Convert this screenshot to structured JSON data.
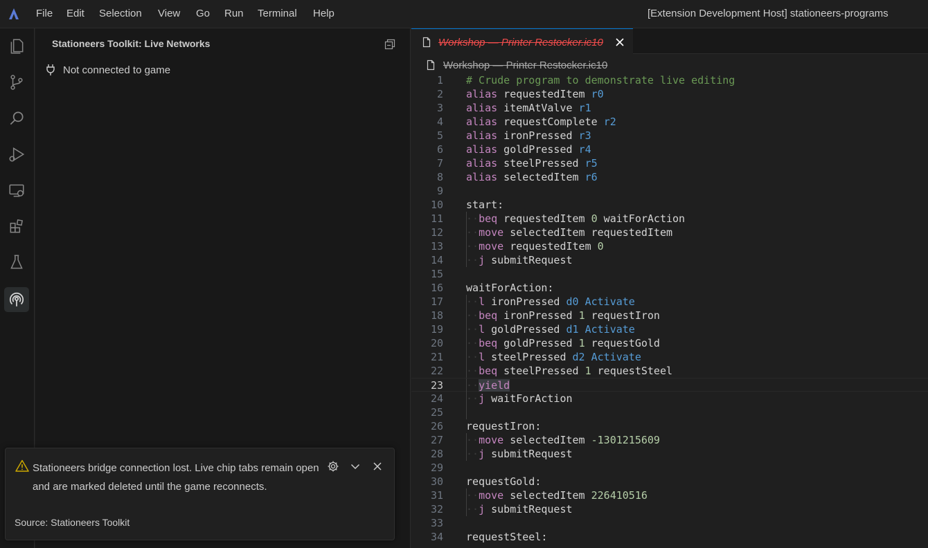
{
  "menu": [
    "File",
    "Edit",
    "Selection",
    "View",
    "Go",
    "Run",
    "Terminal",
    "Help"
  ],
  "window_title": "[Extension Development Host] stationeers-programs",
  "activity_bar": [
    {
      "icon": "explorer-icon"
    },
    {
      "icon": "source-control-icon"
    },
    {
      "icon": "search-icon"
    },
    {
      "icon": "run-and-debug-icon"
    },
    {
      "icon": "remote-explorer-icon"
    },
    {
      "icon": "extensions-icon"
    },
    {
      "icon": "testing-icon"
    },
    {
      "icon": "live-networks-icon",
      "active": true
    }
  ],
  "sidebar": {
    "title": "Stationeers Toolkit: Live Networks",
    "status": "Not connected to game"
  },
  "notification": {
    "message": "Stationeers bridge connection lost. Live chip tabs remain open and are marked deleted until the game reconnects.",
    "source": "Source: Stationeers Toolkit"
  },
  "editor": {
    "tab_label": "Workshop — Printer Restocker.ic10",
    "breadcrumb": "Workshop — Printer Restocker.ic10",
    "current_line": 23,
    "lines": [
      [
        [
          "# Crude program to demonstrate live editing",
          "cmt"
        ]
      ],
      [
        [
          "alias",
          "kw"
        ],
        [
          " requestedItem ",
          "id"
        ],
        [
          "r0",
          "reg"
        ]
      ],
      [
        [
          "alias",
          "kw"
        ],
        [
          " itemAtValve ",
          "id"
        ],
        [
          "r1",
          "reg"
        ]
      ],
      [
        [
          "alias",
          "kw"
        ],
        [
          " requestComplete ",
          "id"
        ],
        [
          "r2",
          "reg"
        ]
      ],
      [
        [
          "alias",
          "kw"
        ],
        [
          " ironPressed ",
          "id"
        ],
        [
          "r3",
          "reg"
        ]
      ],
      [
        [
          "alias",
          "kw"
        ],
        [
          " goldPressed ",
          "id"
        ],
        [
          "r4",
          "reg"
        ]
      ],
      [
        [
          "alias",
          "kw"
        ],
        [
          " steelPressed ",
          "id"
        ],
        [
          "r5",
          "reg"
        ]
      ],
      [
        [
          "alias",
          "kw"
        ],
        [
          " selectedItem ",
          "id"
        ],
        [
          "r6",
          "reg"
        ]
      ],
      [],
      [
        [
          "start:",
          "id"
        ]
      ],
      [
        [
          "··",
          "ws"
        ],
        [
          "beq",
          "kw"
        ],
        [
          " requestedItem ",
          "id"
        ],
        [
          "0",
          "num"
        ],
        [
          " waitForAction",
          "id"
        ]
      ],
      [
        [
          "··",
          "ws"
        ],
        [
          "move",
          "kw"
        ],
        [
          " selectedItem requestedItem",
          "id"
        ]
      ],
      [
        [
          "··",
          "ws"
        ],
        [
          "move",
          "kw"
        ],
        [
          " requestedItem ",
          "id"
        ],
        [
          "0",
          "num"
        ]
      ],
      [
        [
          "··",
          "ws"
        ],
        [
          "j",
          "kw"
        ],
        [
          " submitRequest",
          "id"
        ]
      ],
      [],
      [
        [
          "waitForAction:",
          "id"
        ]
      ],
      [
        [
          "··",
          "ws"
        ],
        [
          "l",
          "kw"
        ],
        [
          " ironPressed ",
          "id"
        ],
        [
          "d0",
          "reg"
        ],
        [
          " ",
          "id"
        ],
        [
          "Activate",
          "reg"
        ]
      ],
      [
        [
          "··",
          "ws"
        ],
        [
          "beq",
          "kw"
        ],
        [
          " ironPressed ",
          "id"
        ],
        [
          "1",
          "num"
        ],
        [
          " requestIron",
          "id"
        ]
      ],
      [
        [
          "··",
          "ws"
        ],
        [
          "l",
          "kw"
        ],
        [
          " goldPressed ",
          "id"
        ],
        [
          "d1",
          "reg"
        ],
        [
          " ",
          "id"
        ],
        [
          "Activate",
          "reg"
        ]
      ],
      [
        [
          "··",
          "ws"
        ],
        [
          "beq",
          "kw"
        ],
        [
          " goldPressed ",
          "id"
        ],
        [
          "1",
          "num"
        ],
        [
          " requestGold",
          "id"
        ]
      ],
      [
        [
          "··",
          "ws"
        ],
        [
          "l",
          "kw"
        ],
        [
          " steelPressed ",
          "id"
        ],
        [
          "d2",
          "reg"
        ],
        [
          " ",
          "id"
        ],
        [
          "Activate",
          "reg"
        ]
      ],
      [
        [
          "··",
          "ws"
        ],
        [
          "beq",
          "kw"
        ],
        [
          " steelPressed ",
          "id"
        ],
        [
          "1",
          "num"
        ],
        [
          " requestSteel",
          "id"
        ]
      ],
      [
        [
          "··",
          "ws"
        ],
        [
          "yield",
          "kw hl"
        ]
      ],
      [
        [
          "··",
          "ws"
        ],
        [
          "j",
          "kw"
        ],
        [
          " waitForAction",
          "id"
        ]
      ],
      [],
      [
        [
          "requestIron:",
          "id"
        ]
      ],
      [
        [
          "··",
          "ws"
        ],
        [
          "move",
          "kw"
        ],
        [
          " selectedItem ",
          "id"
        ],
        [
          "-1301215609",
          "num"
        ]
      ],
      [
        [
          "··",
          "ws"
        ],
        [
          "j",
          "kw"
        ],
        [
          " submitRequest",
          "id"
        ]
      ],
      [],
      [
        [
          "requestGold:",
          "id"
        ]
      ],
      [
        [
          "··",
          "ws"
        ],
        [
          "move",
          "kw"
        ],
        [
          " selectedItem ",
          "id"
        ],
        [
          "226410516",
          "num"
        ]
      ],
      [
        [
          "··",
          "ws"
        ],
        [
          "j",
          "kw"
        ],
        [
          " submitRequest",
          "id"
        ]
      ],
      [],
      [
        [
          "requestSteel:",
          "id"
        ]
      ]
    ]
  }
}
